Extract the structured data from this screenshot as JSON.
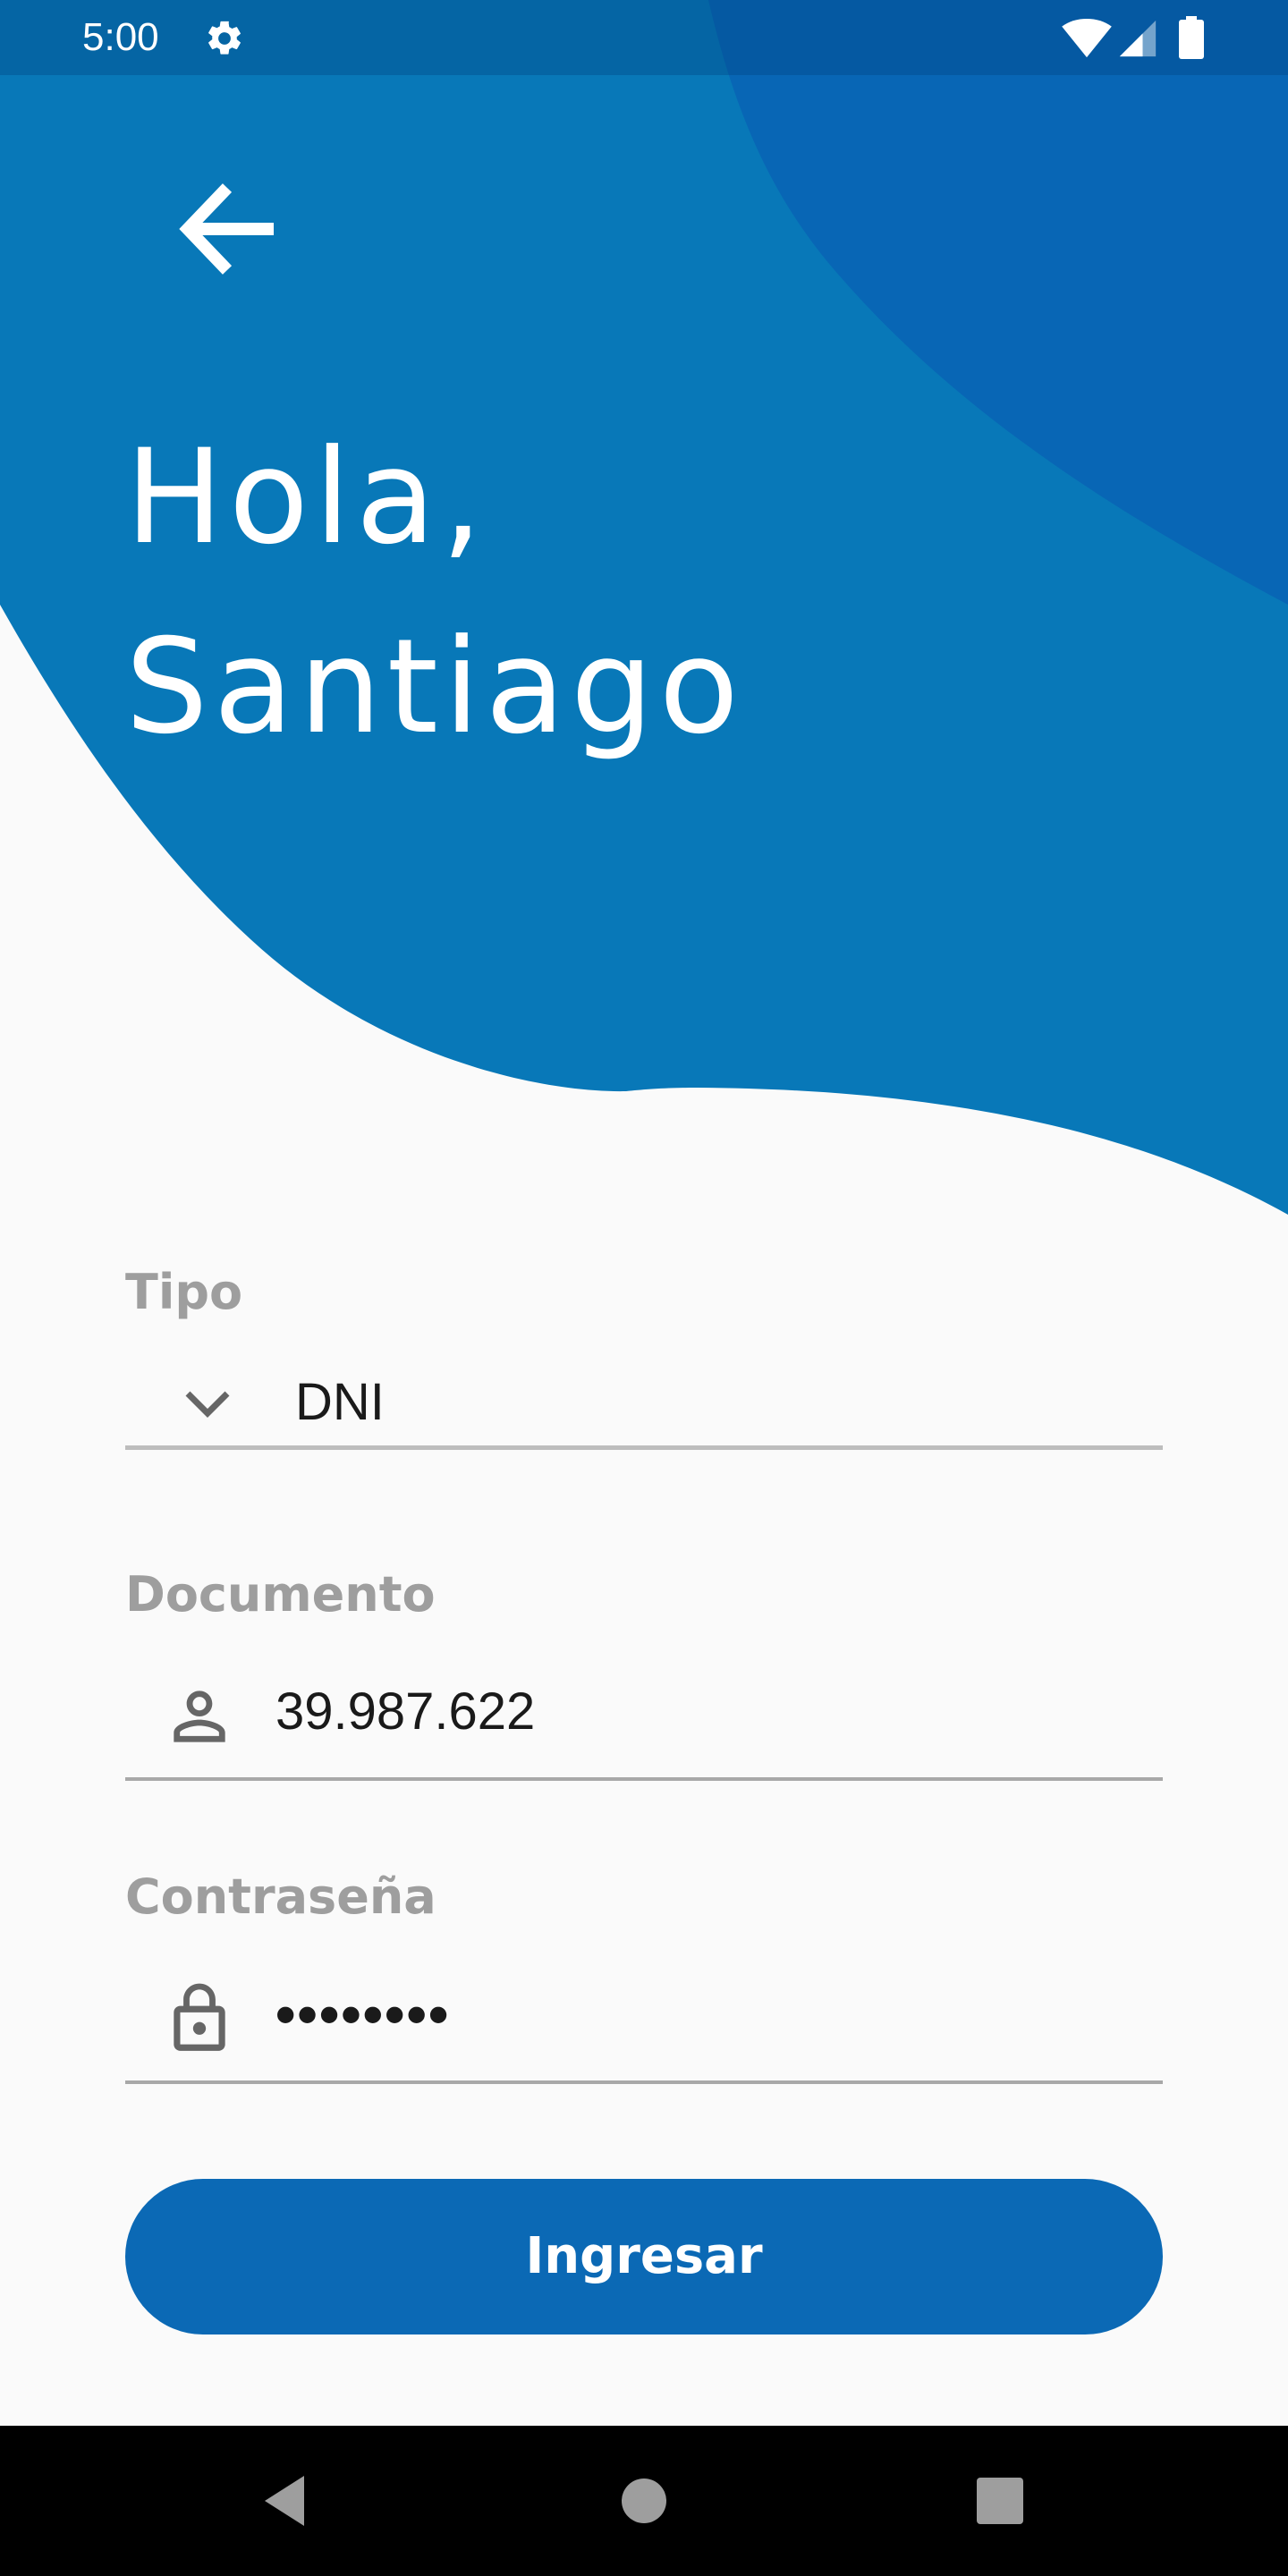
{
  "colors": {
    "primary_blue": "#0878b8",
    "accent_blue": "#0866b5",
    "button_blue": "#0b69b5",
    "background": "#fafafa",
    "label_gray": "#9e9e9e",
    "underline_gray": "#a8a8a8"
  },
  "status_bar": {
    "time": "5:00",
    "icons": [
      "gear-icon",
      "wifi-icon",
      "signal-icon",
      "battery-icon"
    ]
  },
  "header": {
    "back_icon": "arrow-left-icon",
    "greeting_line1": "Hola,",
    "greeting_line2": "Santiago"
  },
  "form": {
    "tipo": {
      "label": "Tipo",
      "value": "DNI",
      "icon": "chevron-down-icon"
    },
    "documento": {
      "label": "Documento",
      "value": "39.987.622",
      "icon": "person-icon"
    },
    "contrasena": {
      "label": "Contraseña",
      "value": "••••••••",
      "icon": "lock-icon"
    },
    "submit_label": "Ingresar"
  },
  "nav_bar": {
    "icons": [
      "nav-back-icon",
      "nav-home-icon",
      "nav-recents-icon"
    ]
  }
}
